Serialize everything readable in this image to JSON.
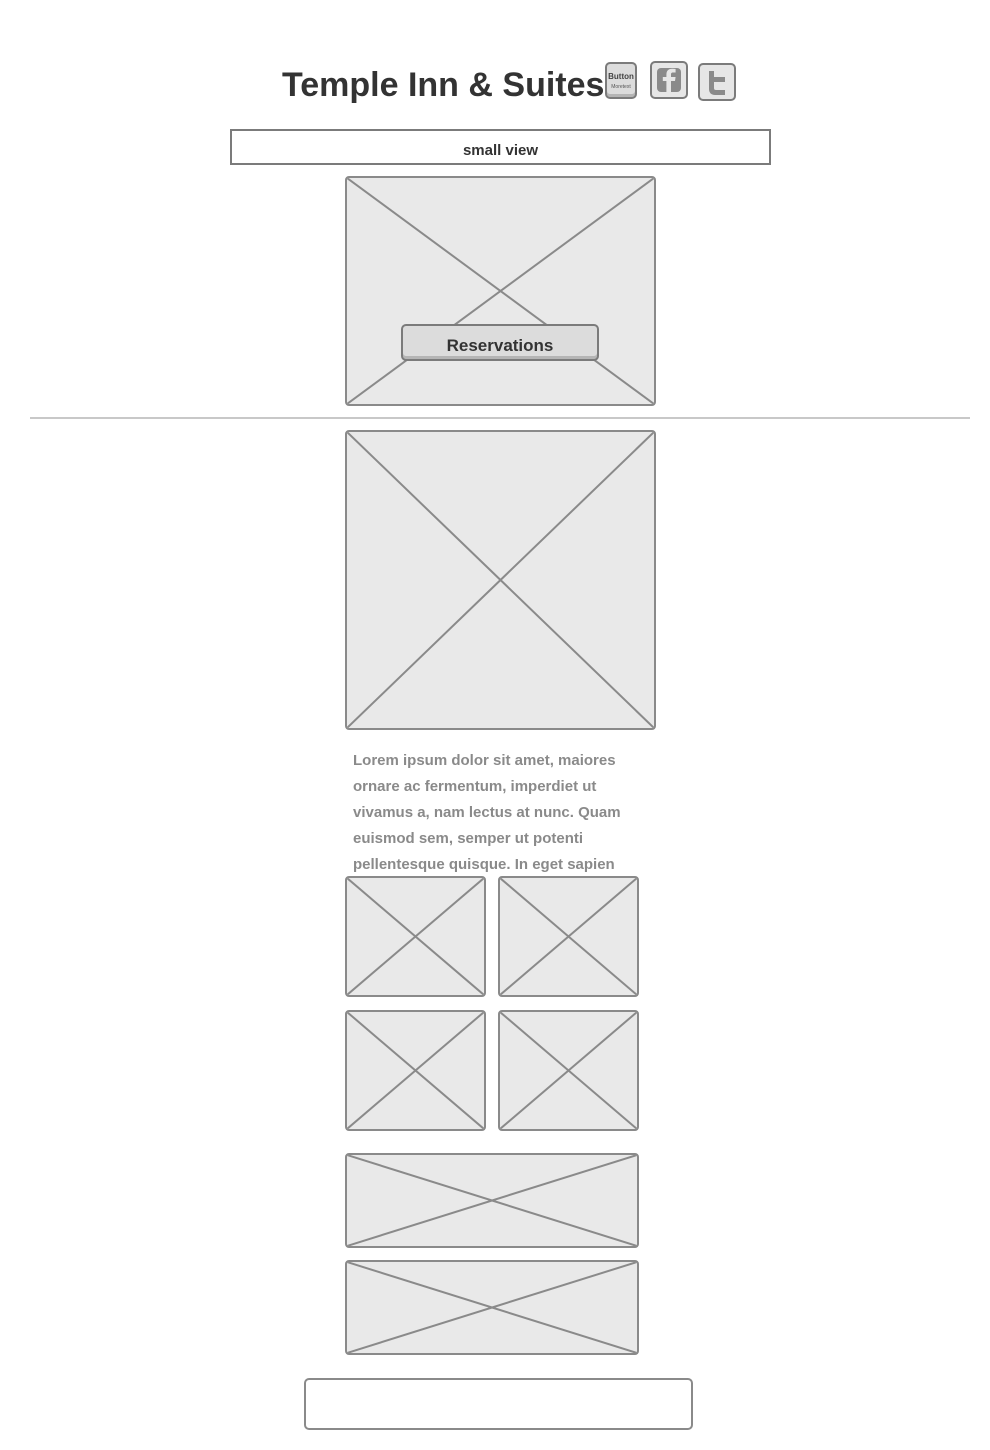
{
  "header": {
    "title": "Temple Inn & Suites",
    "generic_button": {
      "label": "Button",
      "sublabel": "Moretext"
    },
    "facebook_icon": "facebook-icon",
    "twitter_icon": "twitter-icon"
  },
  "nav": {
    "small_view_label": "small view"
  },
  "hero": {
    "reservations_label": "Reservations"
  },
  "content": {
    "paragraph": "Lorem ipsum dolor sit amet, maiores ornare ac fermentum, imperdiet ut vivamus a, nam lectus at nunc. Quam euismod sem, semper ut potenti pellentesque quisque. In eget sapien"
  },
  "colors": {
    "placeholder_fill": "#e9e9e9",
    "placeholder_stroke": "#8a8a8a",
    "text_dark": "#333333",
    "text_muted": "#8a8a8a"
  }
}
